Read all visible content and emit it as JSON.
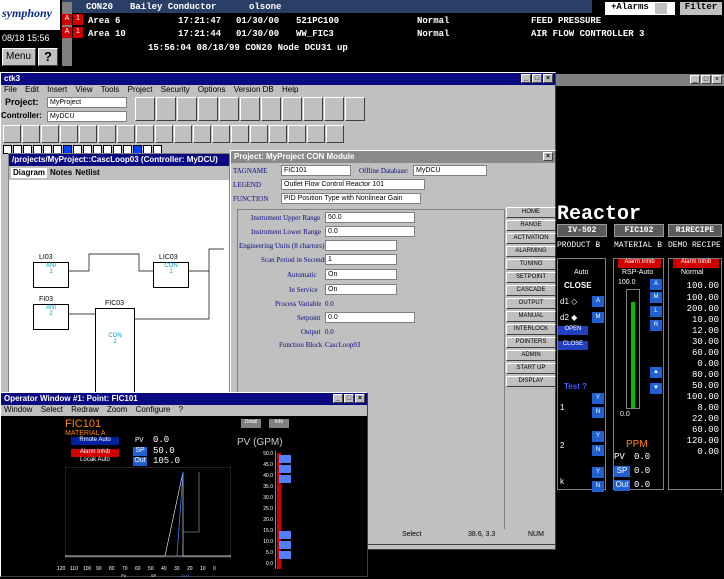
{
  "alarm_strip": {
    "logo": "symphony",
    "time": "08/18 15:56",
    "menu_label": "Menu",
    "help_label": "?",
    "rows": [
      {
        "prio": "",
        "ack": "",
        "tag": "CON20",
        "desc": "Bailey Conductor",
        "source": "olsone",
        "time": "",
        "date": "",
        "code": "",
        "status": "",
        "text": ""
      },
      {
        "prio": "A",
        "ack": "1",
        "tag": "",
        "desc": "Area 6",
        "source": "",
        "time": "17:21:47",
        "date": "01/30/00",
        "code": "521PC100",
        "status": "Normal",
        "text": "FEED PRESSURE"
      },
      {
        "prio": "A",
        "ack": "1",
        "tag": "",
        "desc": "Area 10",
        "source": "",
        "time": "17:21:44",
        "date": "01/30/00",
        "code": "WW_FIC3",
        "status": "Normal",
        "text": "AIR FLOW     CONTROLLER 3"
      }
    ],
    "sys_message": "15:56:04  08/18/99  CON20 Node DCU31 up",
    "alarms_button": "+Alarms",
    "filter_button": "Filter"
  },
  "ctk_window": {
    "title": "ctk3",
    "menu": [
      "File",
      "Edit",
      "Insert",
      "View",
      "Tools",
      "Project",
      "Security",
      "Options",
      "Version DB",
      "Help"
    ],
    "project_label": "Project:",
    "project_value": "MyProject",
    "controller_label": "Controller:",
    "controller_value": "MyDCU"
  },
  "tree_window": {
    "title": "/projects/MyProject::CascLoop03  (Controller: MyDCU)",
    "tabs": [
      "Diagram",
      "Notes",
      "Netlist"
    ],
    "blocks": [
      {
        "name": "LI03",
        "type": "ANI",
        "num": "1"
      },
      {
        "name": "LIC03",
        "type": "CON",
        "num": "1"
      },
      {
        "name": "FI03",
        "type": "ANI",
        "num": "2"
      },
      {
        "name": "FIC03",
        "type": "CON",
        "num": "2"
      }
    ]
  },
  "con_module": {
    "title": "Project: MyProject   CON Module",
    "tagname_label": "TAGNAME",
    "tagname_value": "FIC101",
    "offline_db_label": "Offline Database:",
    "offline_db_value": "MyDCU",
    "legend_label": "LEGEND",
    "legend_value": "Outlet Flow Control Reactor 101",
    "function_label": "FUNCTION",
    "function_value": "PID Position Type with Nonlinear Gain",
    "fields": [
      {
        "label": "Instrument Upper Range",
        "value": "50.0"
      },
      {
        "label": "Instrument Lower Range",
        "value": "0.0"
      },
      {
        "label": "Engineering Units (8 chartors)",
        "value": ""
      },
      {
        "label": "Scan Period in Seconds",
        "value": "1"
      },
      {
        "label": "Automatic",
        "value": "On"
      },
      {
        "label": "In Service",
        "value": "On"
      },
      {
        "label": "Process Variable",
        "value": "0.0"
      },
      {
        "label": "Setpoint",
        "value": "0.0"
      },
      {
        "label": "Output",
        "value": "0.0"
      },
      {
        "label": "Function Block",
        "value": "CascLoop03"
      }
    ],
    "side_buttons": [
      "HOME",
      "RANGE",
      "ACTIVATION",
      "ALARMING",
      "TUNING",
      "SETPOINT",
      "CASCADE",
      "OUTPUT",
      "MANUAL",
      "INTERLOCK",
      "POINTERS",
      "ADMIN",
      "START UP",
      "DISPLAY"
    ]
  },
  "statusbar": {
    "mode": "Select",
    "coords": "38.6, 3.3",
    "num": "NUM"
  },
  "reactor": {
    "title": "Reactor",
    "headers": [
      "IV-502",
      "FIC102",
      "R1RECIPE"
    ],
    "subheaders": [
      "PRODUCT B",
      "MATERIAL B",
      "DEMO RECIPE"
    ],
    "col1": {
      "mode": "Auto",
      "state": "CLOSE",
      "rows": [
        "d1  ◇",
        "d2  ◆"
      ],
      "test": "Test ?",
      "val": "1",
      "val2": "2",
      "k": "k"
    },
    "col2": {
      "inhib": "Alarm Inhib",
      "mode": "RSP-Auto",
      "sp": "100.0",
      "open": "OPEN",
      "close": "CLOSE",
      "zero": "0.0",
      "unit": "PPM",
      "pv_label": "PV",
      "pv": "0.0",
      "sp_label": "SP",
      "sp_val": "0.0",
      "out_label": "Out",
      "out_val": "0.0"
    },
    "col3": {
      "inhib": "Alarm Inhib",
      "mode": "Normal",
      "values": [
        "100.00",
        "100.00",
        "200.00",
        "10.00",
        "12.00",
        "30.00",
        "60.00",
        "0.00",
        "80.00",
        "50.00",
        "100.00",
        "8.00",
        "22.00",
        "60.00",
        "120.00",
        "0.00"
      ]
    }
  },
  "operator_window": {
    "title": "Operator Window #1: Point: FIC101",
    "menu": [
      "Window",
      "Select",
      "Redraw",
      "Zoom",
      "Configure",
      "?"
    ],
    "tag": "FIC101",
    "material": "MATERIAL A",
    "badge1": "Rmote Auto",
    "badge2": "Alarm Inhib",
    "badge3": "Locak Auto",
    "pv_label": "PV",
    "pv_value": "0.0",
    "sp_label": "SP",
    "sp_value": "50.0",
    "out_label": "Out",
    "out_value": "105.0",
    "btn_a": "Detail",
    "btn_b": "Info",
    "gauge_title": "PV (GPM)",
    "gauge_ticks": [
      "50.0",
      "45.0",
      "40.0",
      "35.0",
      "30.0",
      "25.0",
      "20.0",
      "15.0",
      "10.0",
      "5.0",
      "0.0"
    ],
    "trend_ticks": [
      "120",
      "110",
      "100",
      "90",
      "80",
      "70",
      "60",
      "50",
      "40",
      "30",
      "20",
      "10",
      "0"
    ],
    "legend": [
      "PV",
      "SP",
      "OUT"
    ]
  }
}
